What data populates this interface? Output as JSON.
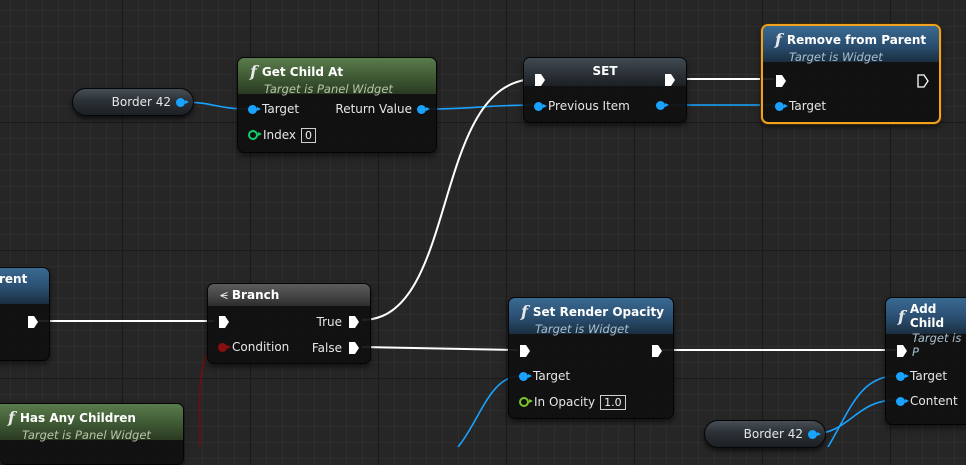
{
  "colors": {
    "exec_wire": "#ffffff",
    "object_pin": "#19a3ff",
    "selected_outline": "#f0a11f"
  },
  "nodes": {
    "border_var_1": {
      "label": "Border 42"
    },
    "border_var_2": {
      "label": "Border 42"
    },
    "get_child_at": {
      "title": "Get Child At",
      "subtitle": "Target is Panel Widget",
      "pins": {
        "target": "Target",
        "return_value": "Return Value",
        "index": "Index",
        "index_value": "0"
      }
    },
    "set": {
      "title": "SET",
      "pins": {
        "previous_item": "Previous Item"
      }
    },
    "remove_from_parent": {
      "title": "Remove from Parent",
      "subtitle": "Target is Widget",
      "pins": {
        "target": "Target"
      }
    },
    "partial_left": {
      "title": "rent"
    },
    "branch": {
      "title": "Branch",
      "pins": {
        "true": "True",
        "false": "False",
        "condition": "Condition"
      }
    },
    "set_render_opacity": {
      "title": "Set Render Opacity",
      "subtitle": "Target is Widget",
      "pins": {
        "target": "Target",
        "in_opacity": "In Opacity",
        "in_opacity_value": "1.0"
      }
    },
    "add_child": {
      "title": "Add Child",
      "subtitle": "Target is P",
      "pins": {
        "target": "Target",
        "content": "Content"
      }
    },
    "has_any_children": {
      "title": "Has Any Children",
      "subtitle": "Target is Panel Widget"
    }
  }
}
